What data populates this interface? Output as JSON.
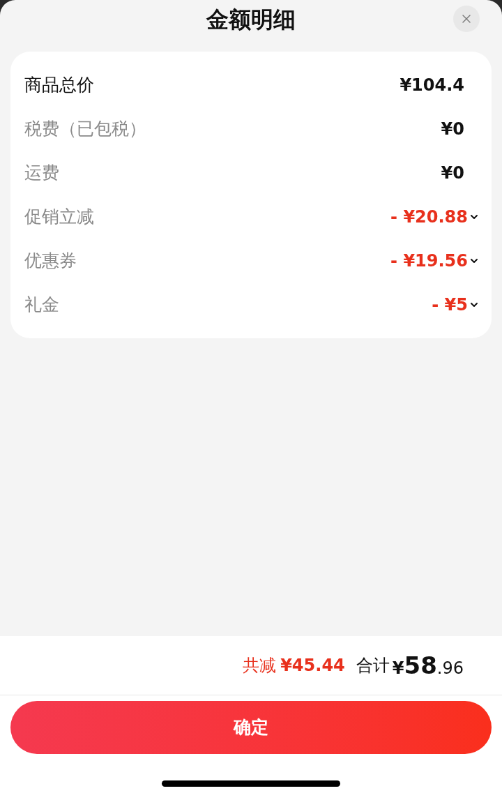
{
  "title": "金额明细",
  "rows": [
    {
      "kind": "total",
      "label": "商品总价",
      "value": "¥104.4"
    },
    {
      "kind": "normal",
      "label": "税费（已包税）",
      "value": "¥0"
    },
    {
      "kind": "normal",
      "label": "运费",
      "value": "¥0"
    },
    {
      "kind": "discount",
      "label": "促销立减",
      "value": "- ¥20.88",
      "expanded": false
    },
    {
      "kind": "discount",
      "label": "优惠券",
      "value": "- ¥19.56",
      "expanded": false
    },
    {
      "kind": "discount",
      "label": "礼金",
      "value": "- ¥5",
      "expanded": false
    }
  ],
  "summary": {
    "savings_label": "共减",
    "savings": "¥45.44",
    "total_label": "合计",
    "total": {
      "currency": "¥",
      "integer": "58",
      "decimal": ".96"
    }
  },
  "confirm_button": "确定"
}
